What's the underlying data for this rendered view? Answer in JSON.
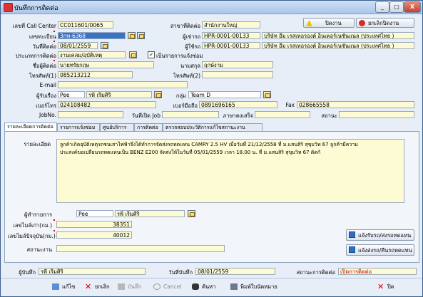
{
  "window": {
    "title": "บันทึกการติดต่อ",
    "minimize": "_",
    "maximize": "□",
    "close": "X"
  },
  "top_actions": {
    "close_job": "ปิดงาน",
    "cancel_close_job": "ยกเลิกปิดงาน"
  },
  "form": {
    "callcenter_no_label": "เลขที่ Call Center",
    "callcenter_no": "CC011601/0065",
    "branch_label": "สาขาที่ติดต่อ",
    "branch": "สำนักงานใหญ่",
    "plate_label": "เลขทะเบียน",
    "plate": "3กท-6368",
    "renter_label": "ผู้เช่ารถ",
    "renter_code": "HPR-0001-00133",
    "renter_name": "บริษัท อีม เรสเทอรองต์ อินเตอร์เนชั่นแนล (ประเทศไทย )",
    "contact_date_label": "วันที่ติดต่อ",
    "contact_date": "08/01/2559",
    "user_label": "ผู้ใช้รถ",
    "user_code": "HPR-0001-00133",
    "user_name": "บริษัท อีม เรสเทอรองต์ อินเตอร์เนชั่นแนล (ประเทศไทย )",
    "contact_type_label": "ประเภทการติดต่อ",
    "contact_type": "งานเคลม/อุบัติเหตุ",
    "repair_item_label": "เป็นรายการแจ้งซ่อม",
    "repair_item_checked": "✔",
    "contact_name_label": "ชื่อผู้ติดต่อ",
    "contact_name": "นายทรัยกฤษ",
    "surname_label": "นามสกุล",
    "surname": "ฤกษ์งาม",
    "phone1_label": "โทรศัพท์(1)",
    "phone1": "085213212",
    "phone2_label": "โทรศัพท์(2)",
    "phone2": "",
    "email_label": "E-mail",
    "email": "",
    "receiver_label": "ผู้รับเรื่อง",
    "receiver_code": "Pee",
    "receiver_name": "รพี เริ่มศิริ",
    "group_label": "กลุ่ม",
    "group": "Team D",
    "office_phone_label": "เบอร์โทร",
    "office_phone": "024108482",
    "mobile_label": "เบอร์มือถือ",
    "mobile": "0891696165",
    "fax_label": "Fax",
    "fax": "028665558",
    "jobno_label": "JobNo.",
    "jobno": "",
    "open_job_date_label": "วันที่เปิด Job",
    "open_job_date": "",
    "expense_type_label": "ภาษาคงเสร็จ",
    "expense_type": "",
    "status_label": "สถานะ",
    "status": ""
  },
  "tabs": [
    "รายละเอียดการติดต่อ",
    "รายการแจ้งซ่อม",
    "ศูนย์บริการ",
    "การติดต่อ",
    "ตรวจสอบประวัติการแก้ไขสถานะงาน"
  ],
  "detail": {
    "detail_label": "รายละเอียด",
    "detail_text_line1": "ลูกค้าเกิดอุบัติเหตุรถชนเสาไฟฟ้าจึงได้ทำการจัดส่งรถทดแทน CAMRY 2.5 HV  เมื่อวันที่ 21/12/2558 ที่ ม.แสนสิริ สุขุมวิท 67 ลูกค้ามีความ",
    "detail_text_line2": "ประสงค์ขอเปลี่ยนรถทดแทนเป็น BENZ E200 จัดส่งให้ในวันที่ 05/01/2559 เวลา 18.00 น. ที่ ม.แสนสิริ สุขุมวิท 67 ติดกั",
    "handler_label": "ผู้ทำรายการ",
    "handler_code": "Pee",
    "handler_name": "รพี เริ่มศิริ",
    "mileage_prev_label": "เลขไมล์เก่า(กม.)",
    "mileage_prev": "38351",
    "mileage_now_label": "เลขไมล์ปัจจุบัน(กม.)",
    "mileage_now": "40012",
    "job_status_label": "สถานะงาน",
    "job_status": "",
    "notify_repair_btn": "แจ้งรับรถ/ส่งรถทดแทน",
    "notify_return_btn": "แจ้งส่งรถ/คืนรถทดแทน"
  },
  "footer": {
    "recorder_label": "ผู้บันทึก",
    "recorder": "รพี เริ่มศิริ",
    "record_date_label": "วันที่บันทึก",
    "record_date": "08/01/2559",
    "contact_status_label": "สถานะการติดต่อ",
    "contact_status": "เปิดการติดต่อ"
  },
  "toolbar": {
    "edit": "แก้ไข",
    "delete": "ยกเลิก",
    "save": "บันทึก",
    "cancel": "Cancel",
    "search": "ค้นหา",
    "print": "พิมพ์ใบนัดหมาย",
    "close": "ปิด"
  }
}
